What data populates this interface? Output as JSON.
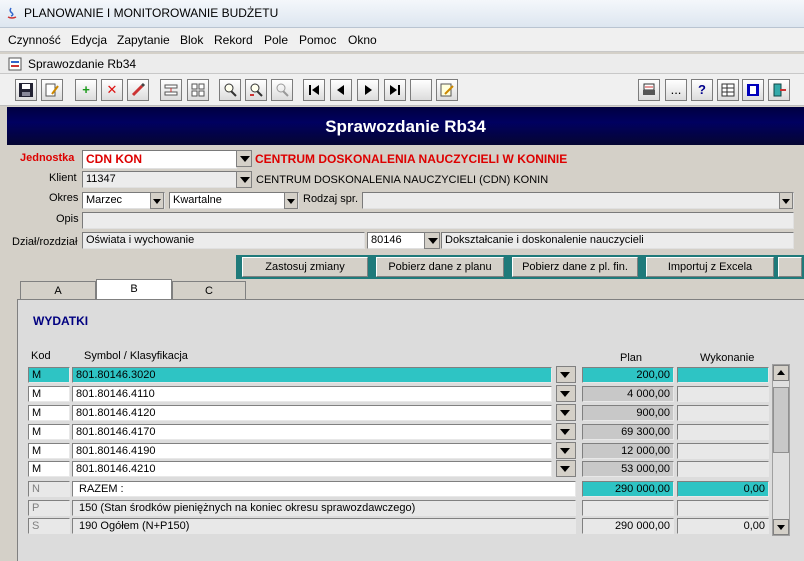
{
  "window": {
    "title": "PLANOWANIE I MONITOROWANIE BUDŻETU"
  },
  "menu": [
    "Czynność",
    "Edycja",
    "Zapytanie",
    "Blok",
    "Rekord",
    "Pole",
    "Pomoc",
    "Okno"
  ],
  "subwindow": {
    "title": "Sprawozdanie Rb34"
  },
  "toolbar": {
    "buttons": [
      "save-icon",
      "edit-icon",
      "add-icon",
      "delete-icon",
      "pencil-icon",
      "split-icon",
      "grid-icon",
      "find-icon",
      "find-next-icon",
      "find-disabled-icon",
      "first-record-icon",
      "prev-record-icon",
      "next-record-icon",
      "last-record-icon",
      "blank-icon",
      "note-icon",
      "print-icon",
      "more-icon",
      "help-icon",
      "table-icon",
      "list-icon",
      "exit-icon"
    ],
    "ellipsis": "...",
    "help": "?"
  },
  "form": {
    "title": "Sprawozdanie Rb34",
    "jednostka": {
      "label": "Jednostka",
      "code": "CDN KON",
      "name": "CENTRUM DOSKONALENIA NAUCZYCIELI W KONINIE"
    },
    "klient": {
      "label": "Klient",
      "code": "11347",
      "name": "CENTRUM DOSKONALENIA NAUCZYCIELI (CDN) KONIN"
    },
    "okres": {
      "label": "Okres",
      "month": "Marzec",
      "period": "Kwartalne"
    },
    "rodzaj": {
      "label": "Rodzaj spr.",
      "value": ""
    },
    "opis": {
      "label": "Opis",
      "value": ""
    },
    "dzial": {
      "label": "Dział/rozdział",
      "dzial_name": "Oświata i wychowanie",
      "rozdzial_code": "80146",
      "rozdzial_name": "Dokształcanie i doskonalenie nauczycieli"
    }
  },
  "actions": [
    "Zastosuj zmiany",
    "Pobierz dane z planu",
    "Pobierz dane z pl. fin.",
    "Importuj z Excela"
  ],
  "tabs": [
    "A",
    "B",
    "C"
  ],
  "active_tab": "B",
  "section": "WYDATKI",
  "columns": {
    "kod": "Kod",
    "symbol": "Symbol / Klasyfikacja",
    "plan": "Plan",
    "wykonanie": "Wykonanie"
  },
  "rows": [
    {
      "kod": "M",
      "symbol": "801.80146.3020",
      "plan": "200,00",
      "wykonanie": ""
    },
    {
      "kod": "M",
      "symbol": "801.80146.4110",
      "plan": "4 000,00",
      "wykonanie": ""
    },
    {
      "kod": "M",
      "symbol": "801.80146.4120",
      "plan": "900,00",
      "wykonanie": ""
    },
    {
      "kod": "M",
      "symbol": "801.80146.4170",
      "plan": "69 300,00",
      "wykonanie": ""
    },
    {
      "kod": "M",
      "symbol": "801.80146.4190",
      "plan": "12 000,00",
      "wykonanie": ""
    },
    {
      "kod": "M",
      "symbol": "801.80146.4210",
      "plan": "53 000,00",
      "wykonanie": ""
    }
  ],
  "summary": [
    {
      "kod": "N",
      "symbol": "RAZEM :",
      "plan": "290 000,00",
      "wykonanie": "0,00"
    },
    {
      "kod": "P",
      "symbol": "150 (Stan środków pieniężnych na koniec okresu sprawozdawczego)",
      "plan": "",
      "wykonanie": ""
    },
    {
      "kod": "S",
      "symbol": "190 Ogółem (N+P150)",
      "plan": "290 000,00",
      "wykonanie": "0,00"
    }
  ]
}
